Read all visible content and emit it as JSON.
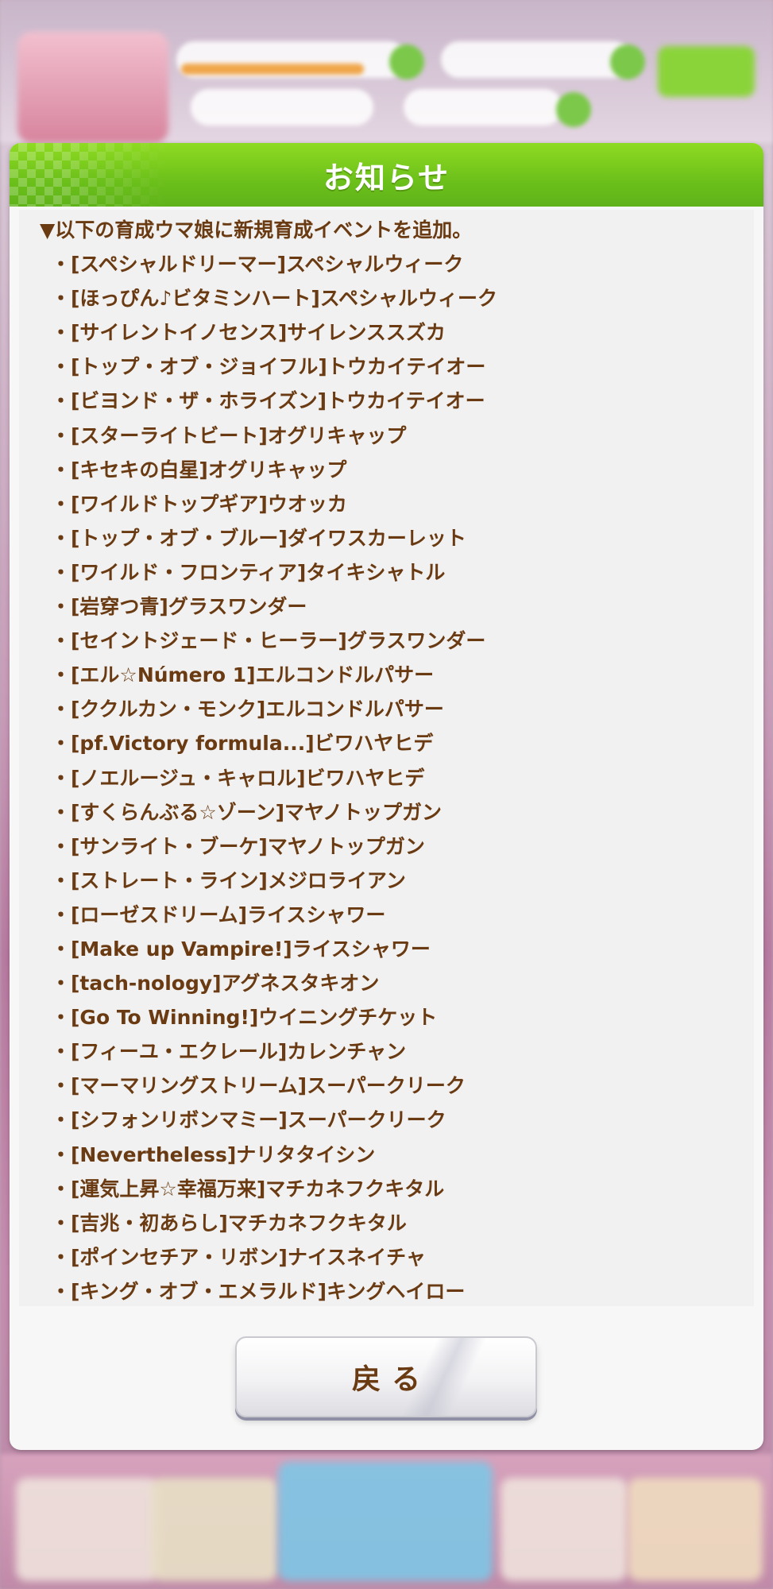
{
  "dialog": {
    "title": "お知らせ",
    "intro": "▼以下の育成ウマ娘に新規育成イベントを追加。",
    "items": [
      "・[スペシャルドリーマー]スペシャルウィーク",
      "・[ほっぴん♪ビタミンハート]スペシャルウィーク",
      "・[サイレントイノセンス]サイレンススズカ",
      "・[トップ・オブ・ジョイフル]トウカイテイオー",
      "・[ビヨンド・ザ・ホライズン]トウカイテイオー",
      "・[スターライトビート]オグリキャップ",
      "・[キセキの白星]オグリキャップ",
      "・[ワイルドトップギア]ウオッカ",
      "・[トップ・オブ・ブルー]ダイワスカーレット",
      "・[ワイルド・フロンティア]タイキシャトル",
      "・[岩穿つ青]グラスワンダー",
      "・[セイントジェード・ヒーラー]グラスワンダー",
      "・[エル☆Número 1]エルコンドルパサー",
      "・[ククルカン・モンク]エルコンドルパサー",
      "・[pf.Victory formula...]ビワハヤヒデ",
      "・[ノエルージュ・キャロル]ビワハヤヒデ",
      "・[すくらんぶる☆ゾーン]マヤノトップガン",
      "・[サンライト・ブーケ]マヤノトップガン",
      "・[ストレート・ライン]メジロライアン",
      "・[ローゼスドリーム]ライスシャワー",
      "・[Make up Vampire!]ライスシャワー",
      "・[tach-nology]アグネスタキオン",
      "・[Go To Winning!]ウイニングチケット",
      "・[フィーユ・エクレール]カレンチャン",
      "・[マーマリングストリーム]スーパークリーク",
      "・[シフォンリボンマミー]スーパークリーク",
      "・[Nevertheless]ナリタタイシン",
      "・[運気上昇☆幸福万来]マチカネフクキタル",
      "・[吉兆・初あらし]マチカネフクキタル",
      "・[ポインセチア・リボン]ナイスネイチャ",
      "・[キング・オブ・エメラルド]キングヘイロー"
    ],
    "back_label": "戻る"
  },
  "colors": {
    "header_green": "#6cc01a",
    "text_brown": "#6a3b12",
    "panel_bg": "#f1f1f1"
  }
}
